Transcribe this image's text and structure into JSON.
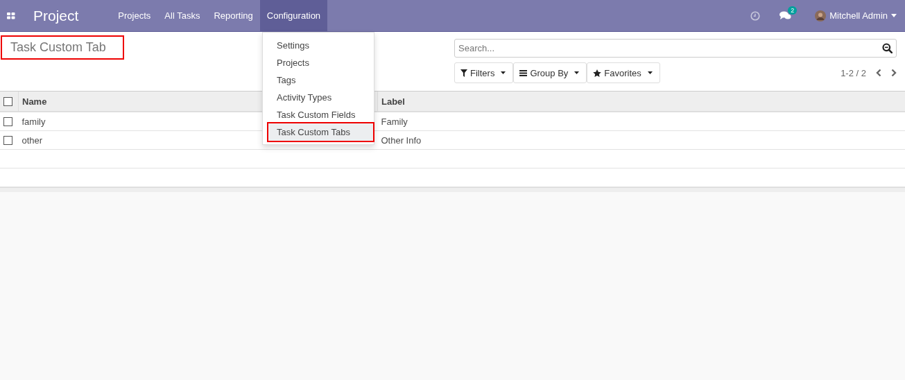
{
  "navbar": {
    "app_name": "Project",
    "menu": [
      {
        "label": "Projects",
        "selected": false
      },
      {
        "label": "All Tasks",
        "selected": false
      },
      {
        "label": "Reporting",
        "selected": false
      },
      {
        "label": "Configuration",
        "selected": true
      }
    ],
    "messages_count": "2",
    "user": "Mitchell Admin"
  },
  "dropdown": {
    "items": [
      {
        "label": "Settings",
        "selected": false,
        "highlighted": false
      },
      {
        "label": "Projects",
        "selected": false,
        "highlighted": false
      },
      {
        "label": "Tags",
        "selected": false,
        "highlighted": false
      },
      {
        "label": "Activity Types",
        "selected": false,
        "highlighted": false
      },
      {
        "label": "Task Custom Fields",
        "selected": false,
        "highlighted": false
      },
      {
        "label": "Task Custom Tabs",
        "selected": true,
        "highlighted": true
      }
    ]
  },
  "control_panel": {
    "title": "Task Custom Tab",
    "title_highlighted": true,
    "search": {
      "placeholder": "Search..."
    },
    "filters": [
      "Filters",
      "Group By",
      "Favorites"
    ],
    "pager": "1-2 / 2"
  },
  "table": {
    "select_all_checked": false,
    "columns": [
      "Name",
      "Label"
    ],
    "rows": [
      {
        "cells": [
          "family",
          "Family"
        ],
        "checked": false
      },
      {
        "cells": [
          "other",
          "Other Info"
        ],
        "checked": false
      }
    ]
  }
}
